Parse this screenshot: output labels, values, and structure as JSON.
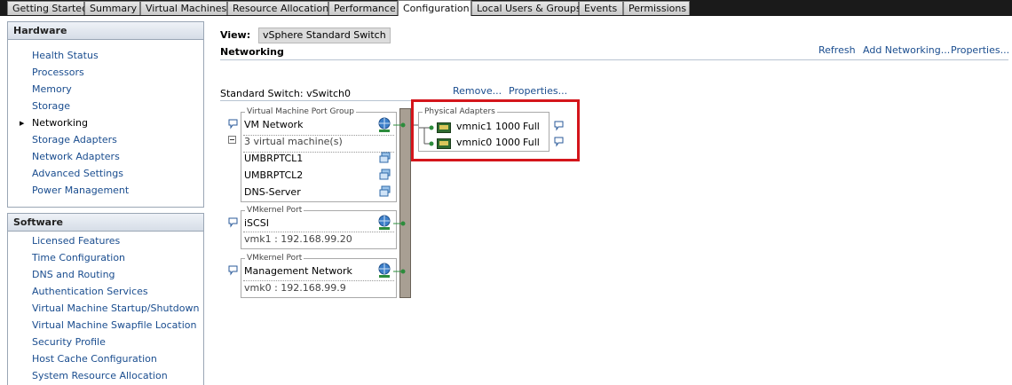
{
  "tabs": [
    "Getting Started",
    "Summary",
    "Virtual Machines",
    "Resource Allocation",
    "Performance",
    "Configuration",
    "Local Users & Groups",
    "Events",
    "Permissions"
  ],
  "active_tab": "Configuration",
  "hardware": {
    "title": "Hardware",
    "items": [
      "Health Status",
      "Processors",
      "Memory",
      "Storage",
      "Networking",
      "Storage Adapters",
      "Network Adapters",
      "Advanced Settings",
      "Power Management"
    ],
    "selected": "Networking"
  },
  "software": {
    "title": "Software",
    "items": [
      "Licensed Features",
      "Time Configuration",
      "DNS and Routing",
      "Authentication Services",
      "Virtual Machine Startup/Shutdown",
      "Virtual Machine Swapfile Location",
      "Security Profile",
      "Host Cache Configuration",
      "System Resource Allocation"
    ]
  },
  "view": {
    "label": "View:",
    "value": "vSphere Standard Switch"
  },
  "networking": {
    "title": "Networking",
    "actions": {
      "refresh": "Refresh",
      "add": "Add Networking...",
      "properties": "Properties..."
    }
  },
  "switch": {
    "title": "Standard Switch: vSwitch0",
    "remove": "Remove...",
    "properties": "Properties...",
    "vm_group": {
      "legend": "Virtual Machine Port Group",
      "name": "VM Network",
      "vm_count": "3 virtual machine(s)",
      "vms": [
        "UMBRPTCL1",
        "UMBRPTCL2",
        "DNS-Server"
      ]
    },
    "vmk1": {
      "legend": "VMkernel Port",
      "name": "iSCSI",
      "detail": "vmk1 : 192.168.99.20"
    },
    "vmk0": {
      "legend": "VMkernel Port",
      "name": "Management Network",
      "detail": "vmk0 : 192.168.99.9"
    },
    "adapters": {
      "legend": "Physical Adapters",
      "list": [
        {
          "name": "vmnic1",
          "speed": "1000",
          "duplex": "Full"
        },
        {
          "name": "vmnic0",
          "speed": "1000",
          "duplex": "Full"
        }
      ]
    }
  },
  "colors": {
    "link": "#1a4d8f",
    "highlight": "#d4151b",
    "bar": "#a89f93",
    "tabbar": "#1a1a1a"
  }
}
